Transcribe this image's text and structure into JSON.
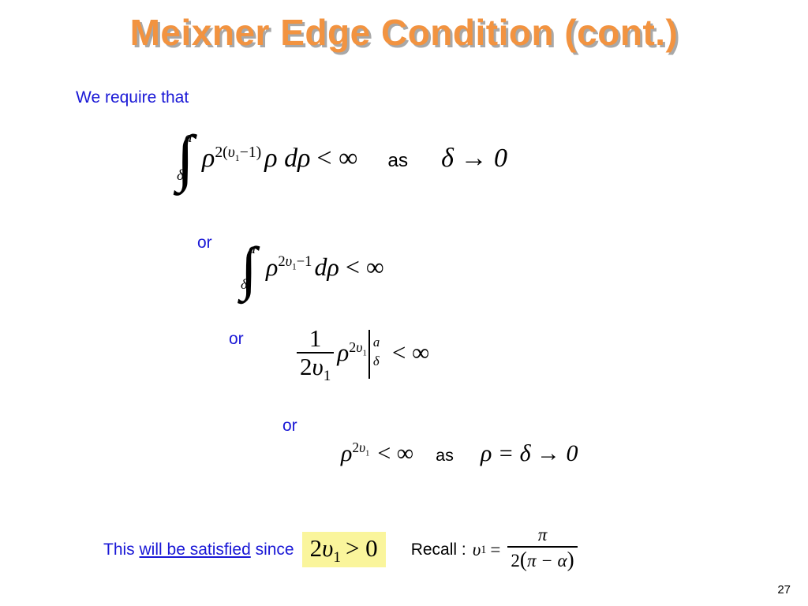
{
  "slide": {
    "title": "Meixner Edge Condition (cont.)",
    "page_number": "27",
    "title_color": "#F29340",
    "title_shadow_color": "#A8A8A8",
    "body_text_color": "#1A18D6",
    "math_color": "#000000",
    "highlight_color": "#FAF59C",
    "background": "#FFFFFF"
  },
  "intro": {
    "text": "We require that"
  },
  "equations": [
    {
      "id": "eq1",
      "connector": "",
      "integral": {
        "lower_limit": "δ",
        "upper_limit": "a"
      },
      "base": "ρ",
      "exponent": "2(υ₁−1)",
      "exponent_parts": {
        "coef": "2(",
        "var": "υ",
        "var_sub": "1",
        "tail": "−1)"
      },
      "integrand_tail": "ρ dρ",
      "relation": "< ∞",
      "as_word": "as",
      "limit_statement": "δ → 0"
    },
    {
      "id": "eq2",
      "connector": "or",
      "integral": {
        "lower_limit": "δ",
        "upper_limit": "a"
      },
      "base": "ρ",
      "exponent": "2υ₁−1",
      "exponent_parts": {
        "coef": "2",
        "var": "υ",
        "var_sub": "1",
        "tail": "−1"
      },
      "integrand_tail": "dρ",
      "relation": "< ∞"
    },
    {
      "id": "eq3",
      "connector": "or",
      "fraction": {
        "numerator": "1",
        "denominator_coef": "2",
        "denominator_var": "υ",
        "denominator_sub": "1"
      },
      "base": "ρ",
      "exponent": "2υ₁",
      "exponent_parts": {
        "coef": "2",
        "var": "υ",
        "var_sub": "1"
      },
      "eval_bar": {
        "upper": "a",
        "lower": "δ"
      },
      "relation": "< ∞"
    },
    {
      "id": "eq4",
      "connector": "or",
      "base": "ρ",
      "exponent": "2υ₁",
      "exponent_parts": {
        "coef": "2",
        "var": "υ",
        "var_sub": "1"
      },
      "relation": "< ∞",
      "as_word": "as",
      "limit_statement": "ρ = δ → 0"
    }
  ],
  "conclusion": {
    "prefix": "This ",
    "underlined": "will be satisfied",
    "suffix": " since",
    "highlight": {
      "coef": "2",
      "var": "υ",
      "var_sub": "1",
      "relation": "> 0",
      "full_text": "2υ₁ > 0"
    }
  },
  "recall": {
    "label": "Recall :",
    "lhs_var": "υ",
    "lhs_sub": "1",
    "equals": "=",
    "numerator": "π",
    "denominator_coef": "2",
    "denominator_open": "(",
    "denominator_body": "π − α",
    "denominator_close": ")",
    "full_text": "υ₁ = π / (2(π − α))"
  }
}
